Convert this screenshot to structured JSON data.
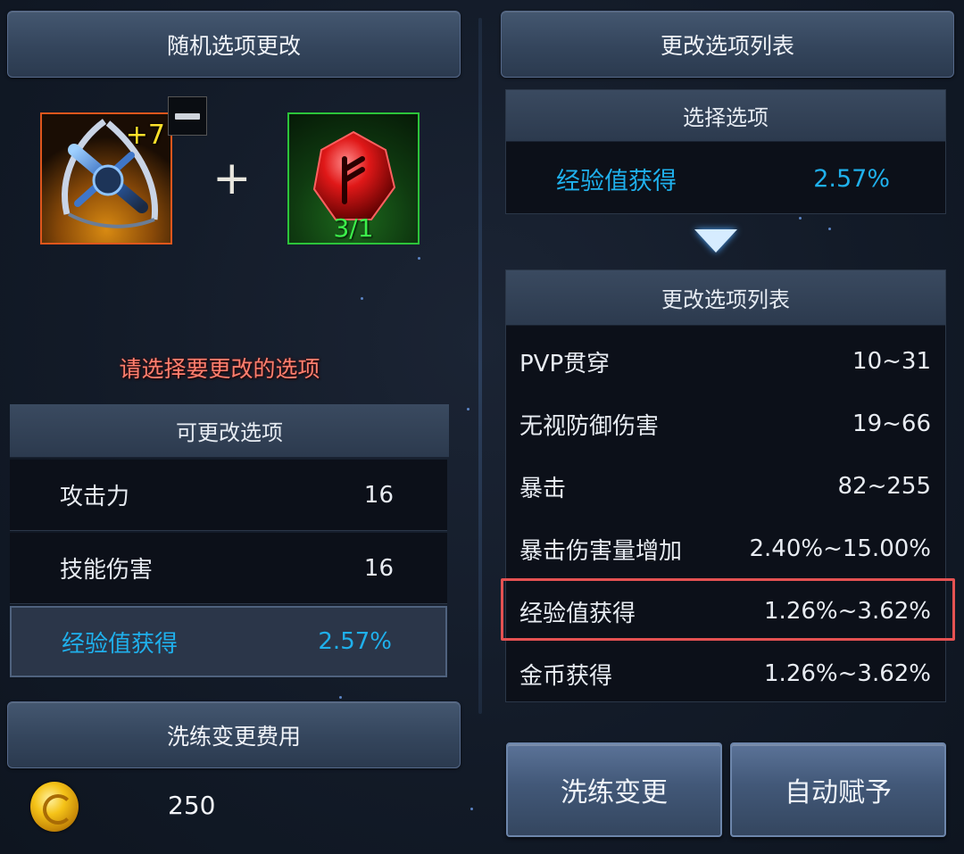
{
  "left": {
    "title": "随机选项更改",
    "weapon": {
      "level": "+7"
    },
    "gem": {
      "count": "3/1"
    },
    "plus": "+",
    "prompt": "请选择要更改的选项",
    "options_header": "可更改选项",
    "options": [
      {
        "label": "攻击力",
        "value": "16"
      },
      {
        "label": "技能伤害",
        "value": "16"
      },
      {
        "label": "经验值获得",
        "value": "2.57%",
        "selected": true
      }
    ],
    "cost_header": "洗练变更费用",
    "cost_value": "250"
  },
  "right": {
    "title": "更改选项列表",
    "selected_header": "选择选项",
    "selected": {
      "label": "经验值获得",
      "value": "2.57%"
    },
    "list_header": "更改选项列表",
    "list": [
      {
        "label": "PVP贯穿",
        "value": "10~31"
      },
      {
        "label": "无视防御伤害",
        "value": "19~66"
      },
      {
        "label": "暴击",
        "value": "82~255"
      },
      {
        "label": "暴击伤害量增加",
        "value": "2.40%~15.00%"
      },
      {
        "label": "经验值获得",
        "value": "1.26%~3.62%",
        "highlighted": true
      },
      {
        "label": "金币获得",
        "value": "1.26%~3.62%"
      }
    ],
    "buttons": {
      "reroll": "洗练变更",
      "auto": "自动赋予"
    }
  },
  "colors": {
    "selected_text": "#1fb0ec",
    "prompt_text": "#ff7f6e",
    "highlight_border": "#e55252",
    "weapon_border": "#e0561c",
    "gem_border": "#2cc43a"
  },
  "icons": [
    "weapon-crossbow-icon",
    "red-rune-gem-icon",
    "minus-icon",
    "down-arrow-icon",
    "gold-coin-icon"
  ]
}
